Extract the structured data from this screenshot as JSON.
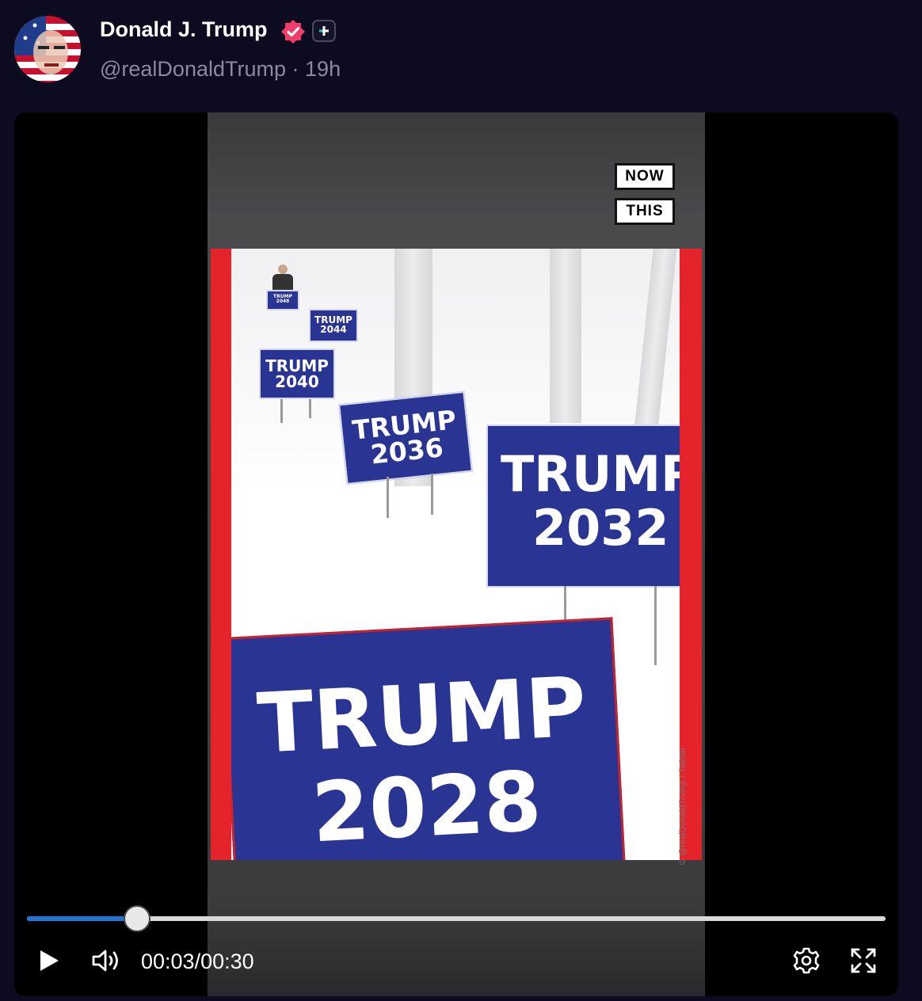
{
  "post": {
    "author_name": "Donald J. Trump",
    "handle": "@realDonaldTrump",
    "separator": "·",
    "age": "19h",
    "verified_color": "#f23d6b"
  },
  "video": {
    "logo_lines": [
      "NOW",
      "THIS"
    ],
    "credit": "© @realDonaldTrump / Twitter",
    "signs": [
      {
        "word": "TRUMP",
        "year": "2048"
      },
      {
        "word": "TRUMP",
        "year": "2044"
      },
      {
        "word": "TRUMP",
        "year": "2040"
      },
      {
        "word": "TRUMP",
        "year": "2036"
      },
      {
        "word": "TRUMP",
        "year": "2032"
      },
      {
        "word": "TRUMP",
        "year": "2028"
      }
    ],
    "sign_color": "#2a3593",
    "frame_accent": "#e5232b"
  },
  "controls": {
    "current_time": "00:03",
    "time_separator": "/",
    "duration": "00:30",
    "progress": 0.128,
    "progress_color": "#1d77d8"
  }
}
